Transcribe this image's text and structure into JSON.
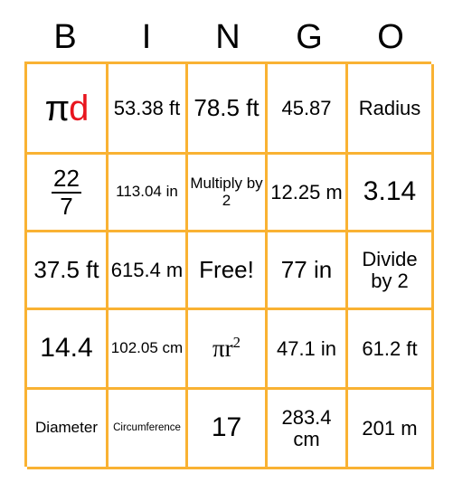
{
  "card": {
    "title": "Pi / Circle Vocabulary Bingo Card",
    "border_color": "#f9b233",
    "text_color": "#000000",
    "accent_color": "#e8151e",
    "background_color": "#ffffff"
  },
  "header": {
    "letters": [
      "B",
      "I",
      "N",
      "G",
      "O"
    ]
  },
  "grid": {
    "rows": 5,
    "columns": 5,
    "cells": [
      [
        {
          "id": "b1",
          "kind": "pi-d",
          "pi": "π",
          "d": "d",
          "text": "πd",
          "size": "pid"
        },
        {
          "id": "i1",
          "kind": "text",
          "text": "53.38 ft",
          "size": "sz-md"
        },
        {
          "id": "n1",
          "kind": "text",
          "text": "78.5 ft",
          "size": "sz-lg"
        },
        {
          "id": "g1",
          "kind": "text",
          "text": "45.87",
          "size": "sz-md"
        },
        {
          "id": "o1",
          "kind": "text",
          "text": "Radius",
          "size": "sz-md"
        }
      ],
      [
        {
          "id": "b2",
          "kind": "fraction",
          "numerator": "22",
          "denominator": "7",
          "text": "22/7",
          "size": "sz-lg"
        },
        {
          "id": "i2",
          "kind": "text",
          "text": "113.04 in",
          "size": "sz-sm"
        },
        {
          "id": "n2",
          "kind": "text",
          "text": "Multiply by 2",
          "size": "sz-sm"
        },
        {
          "id": "g2",
          "kind": "text",
          "text": "12.25 m",
          "size": "sz-md"
        },
        {
          "id": "o2",
          "kind": "text",
          "text": "3.14",
          "size": "sz-xl"
        }
      ],
      [
        {
          "id": "b3",
          "kind": "text",
          "text": "37.5 ft",
          "size": "sz-lg"
        },
        {
          "id": "i3",
          "kind": "text",
          "text": "615.4 m",
          "size": "sz-md"
        },
        {
          "id": "n3",
          "kind": "free",
          "text": "Free!",
          "size": "sz-lg"
        },
        {
          "id": "g3",
          "kind": "text",
          "text": "77 in",
          "size": "sz-lg"
        },
        {
          "id": "o3",
          "kind": "text",
          "text": "Divide by 2",
          "size": "sz-md"
        }
      ],
      [
        {
          "id": "b4",
          "kind": "text",
          "text": "14.4",
          "size": "sz-xl"
        },
        {
          "id": "i4",
          "kind": "text",
          "text": "102.05 cm",
          "size": "sz-sm"
        },
        {
          "id": "n4",
          "kind": "pi-r2",
          "base": "πr",
          "exponent": "2",
          "text": "πr²",
          "size": "pir2"
        },
        {
          "id": "g4",
          "kind": "text",
          "text": "47.1 in",
          "size": "sz-md"
        },
        {
          "id": "o4",
          "kind": "text",
          "text": "61.2 ft",
          "size": "sz-md"
        }
      ],
      [
        {
          "id": "b5",
          "kind": "text",
          "text": "Diameter",
          "size": "sz-sm"
        },
        {
          "id": "i5",
          "kind": "text",
          "text": "Circumference",
          "size": "sz-xs"
        },
        {
          "id": "n5",
          "kind": "text",
          "text": "17",
          "size": "sz-xl"
        },
        {
          "id": "g5",
          "kind": "text",
          "text": "283.4 cm",
          "size": "sz-md"
        },
        {
          "id": "o5",
          "kind": "text",
          "text": "201 m",
          "size": "sz-md"
        }
      ]
    ]
  }
}
